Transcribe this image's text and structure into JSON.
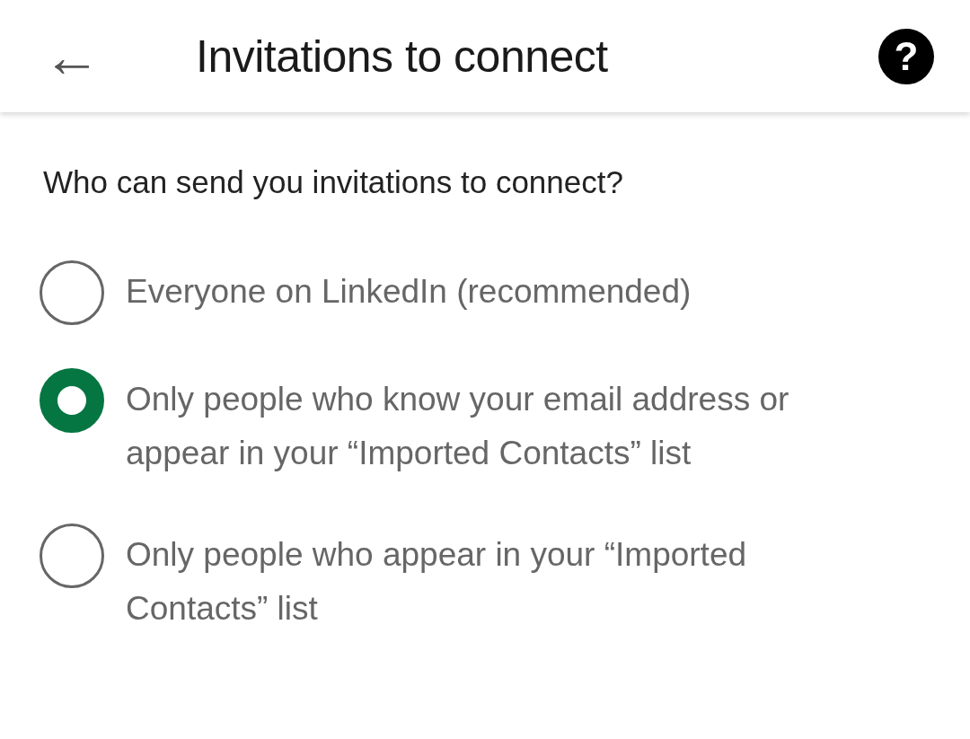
{
  "header": {
    "back": "←",
    "title": "Invitations to connect",
    "help": "?"
  },
  "question": "Who can send you invitations to connect?",
  "options": [
    {
      "label": "Everyone on LinkedIn (recommended)",
      "selected": false
    },
    {
      "label": "Only people who know your email address or appear in your “Imported Contacts” list",
      "selected": true
    },
    {
      "label": "Only people who appear in your “Imported Contacts” list",
      "selected": false
    }
  ]
}
